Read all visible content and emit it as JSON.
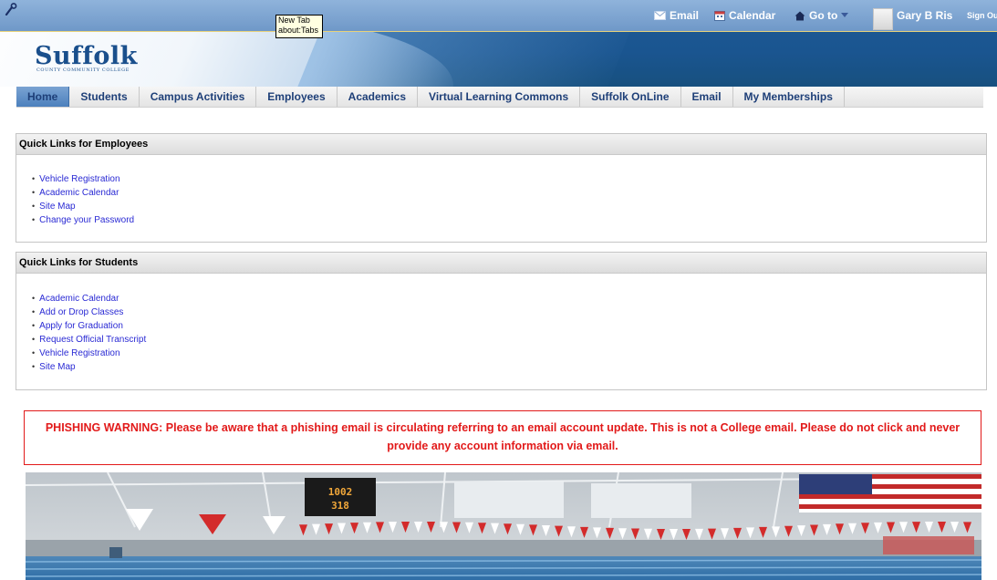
{
  "tooltip": {
    "line1": "New Tab",
    "line2": "about:Tabs"
  },
  "utility": {
    "email_label": "Email",
    "calendar_label": "Calendar",
    "goto_label": "Go to",
    "user_name": "Gary B Ris",
    "signout_label": "Sign Ou"
  },
  "logo": {
    "name": "Suffolk",
    "subtitle": "COUNTY COMMUNITY COLLEGE"
  },
  "nav": {
    "tabs": [
      {
        "label": "Home"
      },
      {
        "label": "Students"
      },
      {
        "label": "Campus Activities"
      },
      {
        "label": "Employees"
      },
      {
        "label": "Academics"
      },
      {
        "label": "Virtual Learning Commons"
      },
      {
        "label": "Suffolk OnLine"
      },
      {
        "label": "Email"
      },
      {
        "label": "My Memberships"
      }
    ],
    "active_index": 0
  },
  "employees": {
    "title": "Quick Links for Employees",
    "links": [
      "Vehicle Registration",
      "Academic Calendar",
      "Site Map",
      "Change your Password"
    ]
  },
  "students": {
    "title": "Quick Links for Students",
    "links": [
      "Academic Calendar",
      "Add or Drop Classes",
      "Apply for Graduation",
      "Request Official Transcript",
      "Vehicle Registration",
      "Site Map"
    ]
  },
  "warning": {
    "text": "PHISHING WARNING: Please be aware that a phishing email is circulating referring to an email account update. This is not a College email. Please do not click and never provide any account information via email."
  },
  "scoreboard": {
    "line1": "1002",
    "line2": "318"
  },
  "colors": {
    "header_blue": "#1e5a96",
    "nav_active": "#4c80bd",
    "link_blue": "#2a2ad4",
    "warning_red": "#e21a1a"
  }
}
